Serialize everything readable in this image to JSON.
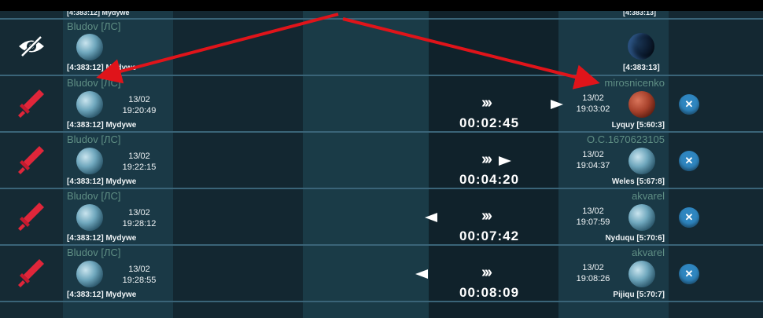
{
  "top_row": {
    "left_coord": "[4:383:12] Mydywe",
    "right_coord": "[4:383:13]"
  },
  "header_row": {
    "player": "Bludov [ЛС]",
    "left_coord": "[4:383:12] Mydywe",
    "right_coord": "[4:383:13]",
    "icon": "eye-slash-icon"
  },
  "fleets": [
    {
      "player": "Bludov [ЛС]",
      "date_left": "13/02",
      "time_left": "19:20:49",
      "left_coord": "[4:383:12] Mydywe",
      "timer": "00:02:45",
      "chevrons": "›››",
      "target_player": "mirosnicenko",
      "date_right": "13/02",
      "time_right": "19:03:02",
      "right_coord": "Lyquy [5:60:3]",
      "planet": "red"
    },
    {
      "player": "Bludov [ЛС]",
      "date_left": "13/02",
      "time_left": "19:22:15",
      "left_coord": "[4:383:12] Mydywe",
      "timer": "00:04:20",
      "chevrons": "›››",
      "target_player": "O.C.1670623105",
      "date_right": "13/02",
      "time_right": "19:04:37",
      "right_coord": "Weles [5:67:8]",
      "planet": "blue"
    },
    {
      "player": "Bludov [ЛС]",
      "date_left": "13/02",
      "time_left": "19:28:12",
      "left_coord": "[4:383:12] Mydywe",
      "timer": "00:07:42",
      "chevrons": "›››",
      "target_player": "akvarel",
      "date_right": "13/02",
      "time_right": "19:07:59",
      "right_coord": "Nyduqu [5:70:6]",
      "planet": "blue"
    },
    {
      "player": "Bludov [ЛС]",
      "date_left": "13/02",
      "time_left": "19:28:55",
      "left_coord": "[4:383:12] Mydywe",
      "timer": "00:08:09",
      "chevrons": "›››",
      "target_player": "akvarel",
      "date_right": "13/02",
      "time_right": "19:08:26",
      "right_coord": "Pijiqu [5:70:7]",
      "planet": "blue"
    }
  ],
  "icons": {
    "attack": "sword-icon",
    "cancel": "close-icon",
    "hide": "eye-slash-icon"
  },
  "colors": {
    "accent_blue": "#2f86c0",
    "annotation_red": "#e0141a",
    "player_green": "#5f8e84"
  }
}
